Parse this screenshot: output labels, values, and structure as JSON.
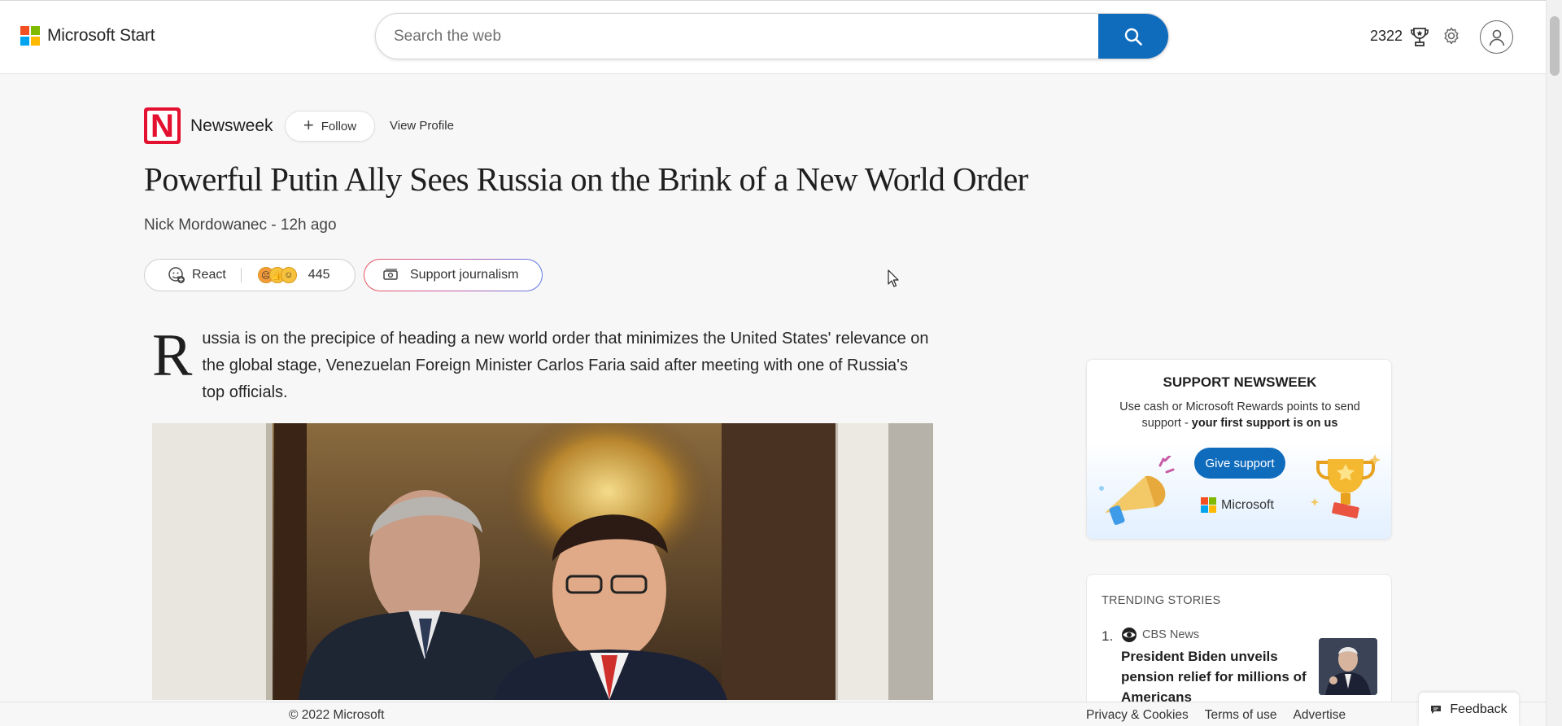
{
  "header": {
    "brand": "Microsoft Start",
    "search_placeholder": "Search the web",
    "points": "2322"
  },
  "publisher": {
    "logo_letter": "N",
    "name": "Newsweek",
    "follow_label": "Follow",
    "view_profile_label": "View Profile"
  },
  "article": {
    "title": "Powerful Putin Ally Sees Russia on the Brink of a New World Order",
    "byline": "Nick Mordowanec - 12h ago",
    "react_label": "React",
    "react_count": "445",
    "support_label": "Support journalism",
    "dropcap": "R",
    "lead_text": "ussia is on the precipice of heading a new world order that minimizes the United States' relevance on the global stage, Venezuelan Foreign Minister Carlos Faria said after meeting with one of Russia's top officials."
  },
  "support_card": {
    "title": "SUPPORT NEWSWEEK",
    "desc_prefix": "Use cash or Microsoft Rewards points to send support - ",
    "desc_bold": "your first support is on us",
    "button_label": "Give support",
    "brand": "Microsoft"
  },
  "trending": {
    "title": "TRENDING STORIES",
    "items": [
      {
        "number": "1.",
        "source": "CBS News",
        "headline": "President Biden unveils pension relief for millions of Americans"
      }
    ]
  },
  "footer": {
    "copyright": "© 2022 Microsoft",
    "links": [
      "Privacy & Cookies",
      "Terms of use",
      "Advertise"
    ],
    "feedback_label": "Feedback"
  },
  "colors": {
    "accent": "#0f6cbd",
    "newsweek_red": "#e4102f",
    "ms_red": "#f25022",
    "ms_green": "#7fba00",
    "ms_blue": "#00a4ef",
    "ms_yellow": "#ffb900"
  }
}
